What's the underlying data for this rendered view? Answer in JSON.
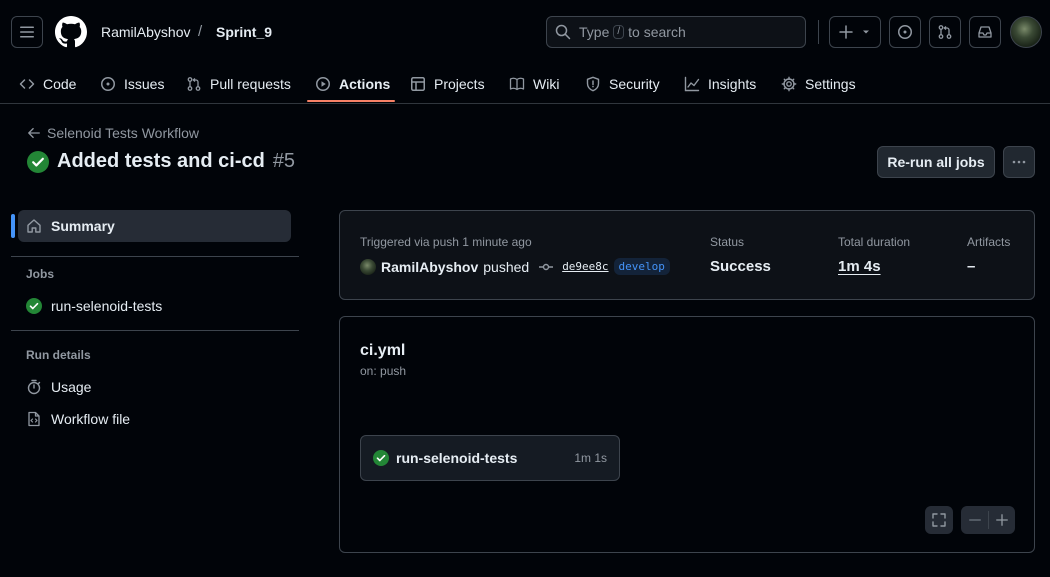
{
  "header": {
    "owner": "RamilAbyshov",
    "separator": "/",
    "repo": "Sprint_9",
    "search": {
      "prefix": "Type",
      "key": "/",
      "suffix": "to search"
    }
  },
  "tabs": [
    {
      "label": "Code",
      "icon": "code-icon"
    },
    {
      "label": "Issues",
      "icon": "issue-opened-icon"
    },
    {
      "label": "Pull requests",
      "icon": "git-pull-request-icon"
    },
    {
      "label": "Actions",
      "icon": "play-icon",
      "active": true
    },
    {
      "label": "Projects",
      "icon": "table-icon"
    },
    {
      "label": "Wiki",
      "icon": "book-icon"
    },
    {
      "label": "Security",
      "icon": "shield-icon"
    },
    {
      "label": "Insights",
      "icon": "graph-icon"
    },
    {
      "label": "Settings",
      "icon": "gear-icon"
    }
  ],
  "page": {
    "back_label": "Selenoid Tests Workflow",
    "run_title": "Added tests and ci-cd",
    "run_number": "#5",
    "rerun_label": "Re-run all jobs"
  },
  "sidebar": {
    "summary_label": "Summary",
    "jobs_heading": "Jobs",
    "jobs": [
      {
        "label": "run-selenoid-tests",
        "status": "success"
      }
    ],
    "run_details_heading": "Run details",
    "details": [
      {
        "label": "Usage",
        "icon": "stopwatch-icon"
      },
      {
        "label": "Workflow file",
        "icon": "file-code-icon"
      }
    ]
  },
  "summary": {
    "triggered_label": "Triggered via push 1 minute ago",
    "actor": "RamilAbyshov",
    "action": "pushed",
    "commit_sha": "de9ee8c",
    "branch": "develop",
    "status_label": "Status",
    "status_value": "Success",
    "duration_label": "Total duration",
    "duration_value": "1m 4s",
    "artifacts_label": "Artifacts",
    "artifacts_value": "–"
  },
  "graph": {
    "workflow_file": "ci.yml",
    "trigger": "on: push",
    "job": {
      "name": "run-selenoid-tests",
      "duration": "1m 1s",
      "status": "success"
    }
  },
  "colors": {
    "background": "#010409",
    "success": "#238636",
    "accent_underline": "#f78166",
    "link": "#4493f8"
  }
}
